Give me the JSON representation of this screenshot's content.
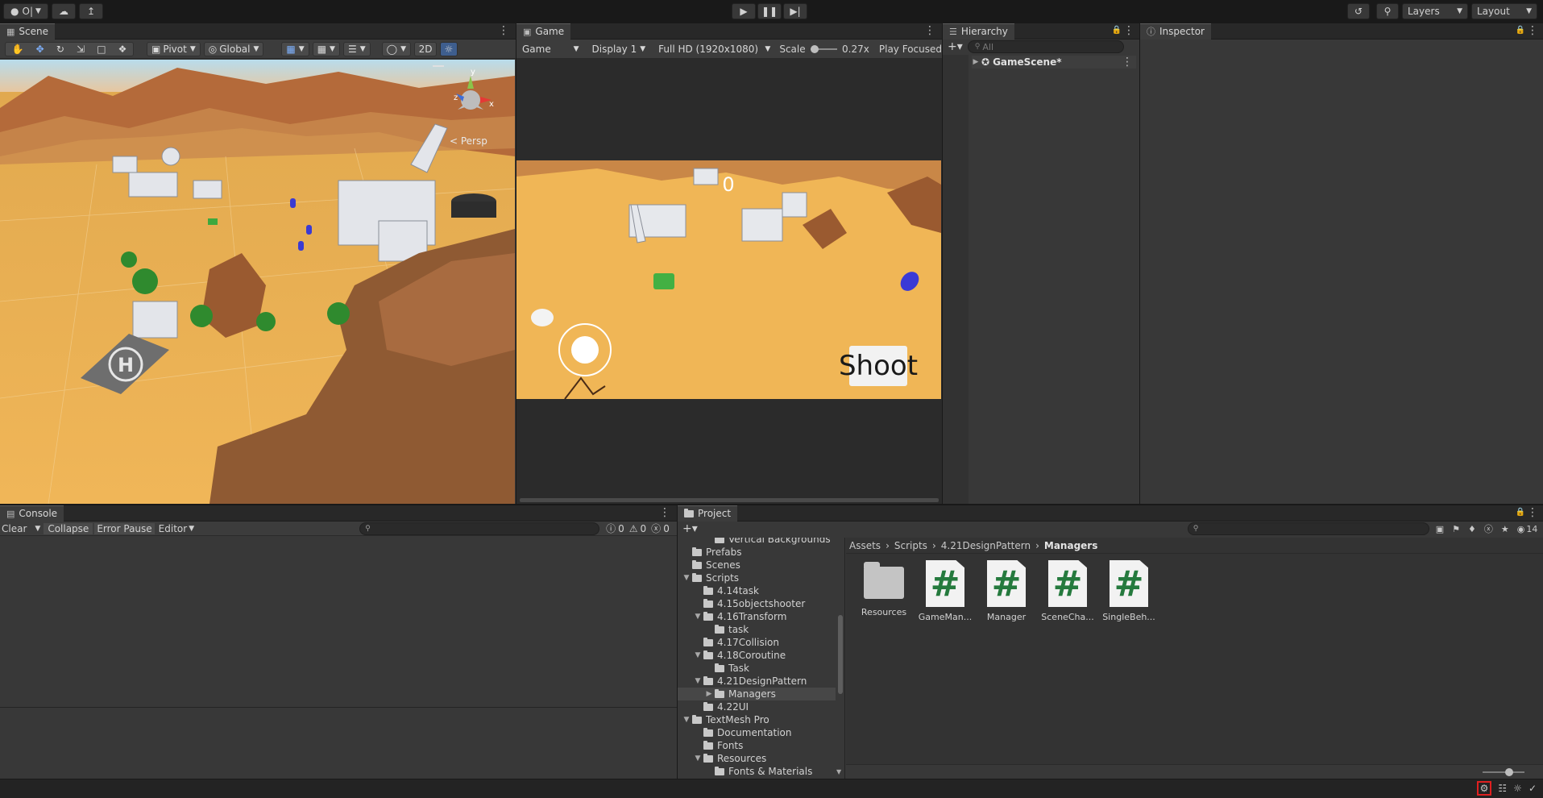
{
  "toolbar": {
    "account_label": "O|",
    "layers_label": "Layers",
    "layout_label": "Layout"
  },
  "scene": {
    "tab_label": "Scene",
    "pivot_label": "Pivot",
    "global_label": "Global",
    "mode_2d": "2D",
    "persp_label": "< Persp",
    "gizmo_axes": {
      "x": "x",
      "y": "y",
      "z": "z"
    }
  },
  "game": {
    "tab_label": "Game",
    "view_select": "Game",
    "display_select": "Display 1",
    "resolution_select": "Full HD (1920x1080)",
    "scale_label": "Scale",
    "scale_value": "0.27x",
    "play_mode": "Play Focused",
    "score": "0",
    "shoot_label": "Shoot"
  },
  "hierarchy": {
    "tab_label": "Hierarchy",
    "search_placeholder": "All",
    "scene_name": "GameScene*"
  },
  "inspector": {
    "tab_label": "Inspector"
  },
  "console": {
    "tab_label": "Console",
    "clear_label": "Clear",
    "collapse_label": "Collapse",
    "error_pause_label": "Error Pause",
    "editor_label": "Editor",
    "log_count": "0",
    "warn_count": "0",
    "error_count": "0"
  },
  "project": {
    "tab_label": "Project",
    "visible_count": "14",
    "tree": [
      {
        "label": "Vertical Backgrounds",
        "indent": 3,
        "open": false,
        "leaf": true
      },
      {
        "label": "Prefabs",
        "indent": 1,
        "open": false,
        "leaf": true
      },
      {
        "label": "Scenes",
        "indent": 1,
        "open": false,
        "leaf": true
      },
      {
        "label": "Scripts",
        "indent": 1,
        "open": true,
        "leaf": false
      },
      {
        "label": "4.14task",
        "indent": 2,
        "open": false,
        "leaf": true
      },
      {
        "label": "4.15objectshooter",
        "indent": 2,
        "open": false,
        "leaf": true
      },
      {
        "label": "4.16Transform",
        "indent": 2,
        "open": true,
        "leaf": false
      },
      {
        "label": "task",
        "indent": 3,
        "open": false,
        "leaf": true
      },
      {
        "label": "4.17Collision",
        "indent": 2,
        "open": false,
        "leaf": true
      },
      {
        "label": "4.18Coroutine",
        "indent": 2,
        "open": true,
        "leaf": false
      },
      {
        "label": "Task",
        "indent": 3,
        "open": false,
        "leaf": true
      },
      {
        "label": "4.21DesignPattern",
        "indent": 2,
        "open": true,
        "leaf": false
      },
      {
        "label": "Managers",
        "indent": 3,
        "open": false,
        "leaf": false,
        "selected": true
      },
      {
        "label": "4.22UI",
        "indent": 2,
        "open": false,
        "leaf": true
      },
      {
        "label": "TextMesh Pro",
        "indent": 1,
        "open": true,
        "leaf": false
      },
      {
        "label": "Documentation",
        "indent": 2,
        "open": false,
        "leaf": true
      },
      {
        "label": "Fonts",
        "indent": 2,
        "open": false,
        "leaf": true
      },
      {
        "label": "Resources",
        "indent": 2,
        "open": true,
        "leaf": false
      },
      {
        "label": "Fonts & Materials",
        "indent": 3,
        "open": false,
        "leaf": true
      }
    ],
    "breadcrumb": [
      "Assets",
      "Scripts",
      "4.21DesignPattern",
      "Managers"
    ],
    "assets": [
      {
        "label": "Resources",
        "kind": "folder"
      },
      {
        "label": "GameMan...",
        "kind": "script"
      },
      {
        "label": "Manager",
        "kind": "script"
      },
      {
        "label": "SceneCha...",
        "kind": "script"
      },
      {
        "label": "SingleBeh...",
        "kind": "script"
      }
    ]
  }
}
